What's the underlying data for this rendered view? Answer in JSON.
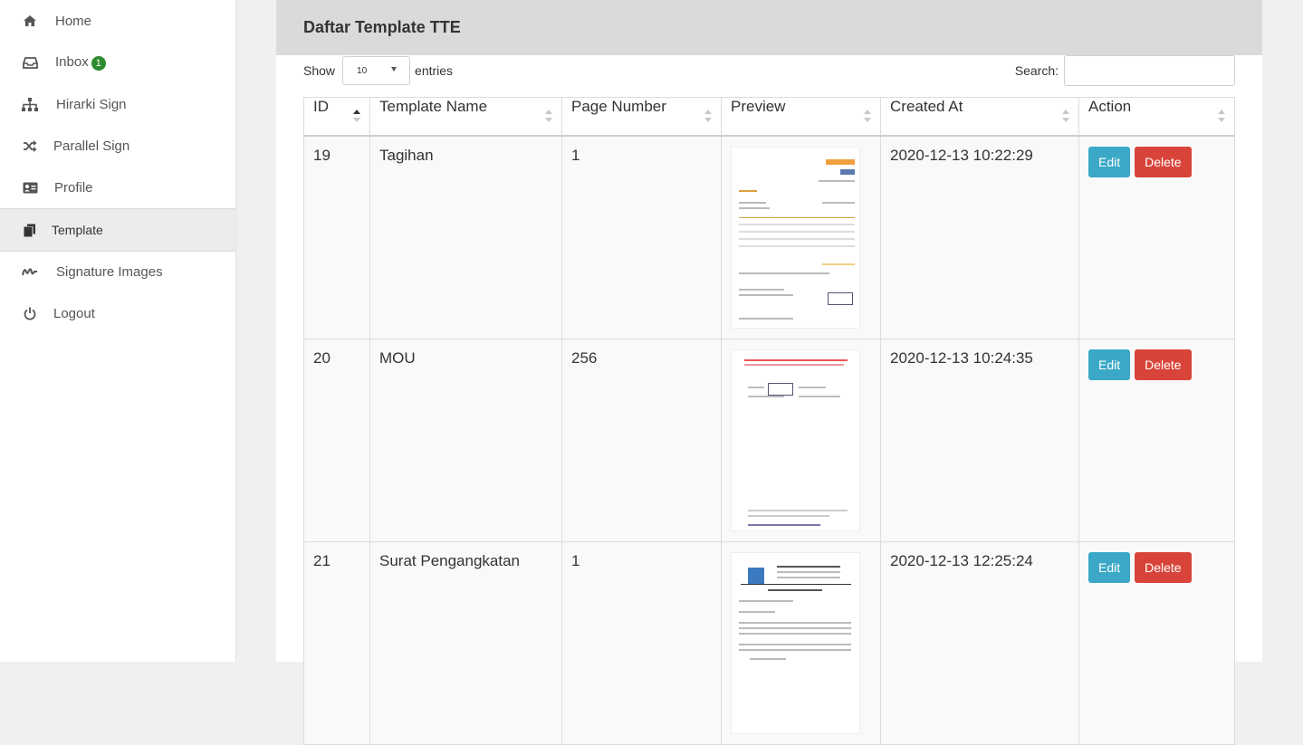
{
  "sidebar": {
    "items": [
      {
        "label": "Home",
        "icon": "home-icon"
      },
      {
        "label": "Inbox",
        "icon": "inbox-icon",
        "badge": "1"
      },
      {
        "label": "Hirarki Sign",
        "icon": "sitemap-icon"
      },
      {
        "label": "Parallel Sign",
        "icon": "shuffle-icon"
      },
      {
        "label": "Profile",
        "icon": "id-card-icon"
      },
      {
        "label": "Template",
        "icon": "copy-icon",
        "active": true
      },
      {
        "label": "Signature Images",
        "icon": "signature-icon"
      },
      {
        "label": "Logout",
        "icon": "power-icon"
      }
    ]
  },
  "panel": {
    "title": "Daftar Template TTE",
    "show_label": "Show",
    "entries_value": "10",
    "entries_label": "entries",
    "search_label": "Search:",
    "search_value": ""
  },
  "table": {
    "headers": [
      "ID",
      "Template Name",
      "Page Number",
      "Preview",
      "Created At",
      "Action"
    ],
    "rows": [
      {
        "id": "19",
        "name": "Tagihan",
        "page": "1",
        "created": "2020-12-13 10:22:29"
      },
      {
        "id": "20",
        "name": "MOU",
        "page": "256",
        "created": "2020-12-13 10:24:35"
      },
      {
        "id": "21",
        "name": "Surat Pengangkatan",
        "page": "1",
        "created": "2020-12-13 12:25:24"
      }
    ],
    "edit_label": "Edit",
    "delete_label": "Delete"
  },
  "colors": {
    "edit": "#3aa8c6",
    "delete": "#d9443a",
    "badge": "#2e8b2e",
    "header_bg": "#dadada"
  }
}
